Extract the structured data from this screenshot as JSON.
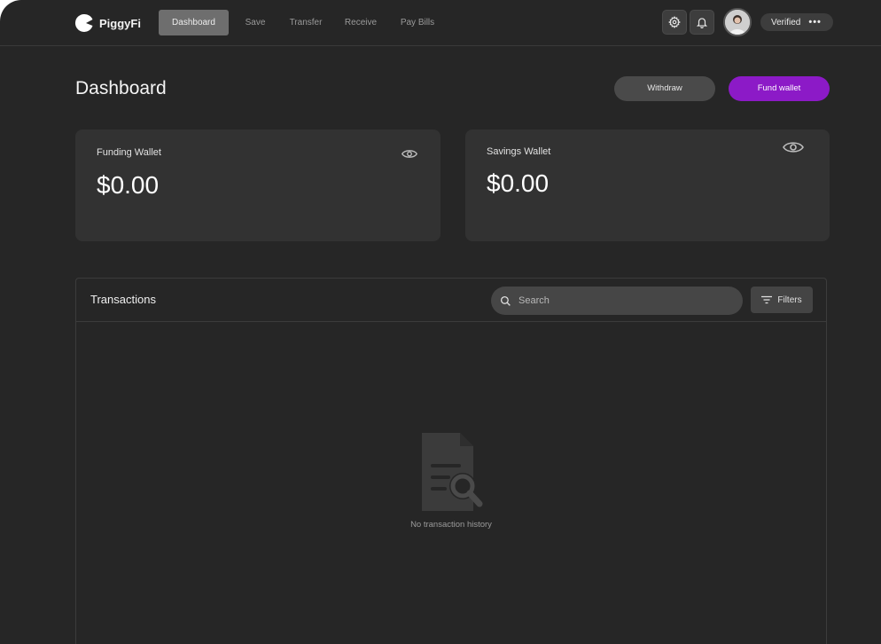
{
  "brand": {
    "name": "PiggyFi"
  },
  "nav": {
    "items": [
      {
        "label": "Dashboard",
        "active": true
      },
      {
        "label": "Save",
        "active": false
      },
      {
        "label": "Transfer",
        "active": false
      },
      {
        "label": "Receive",
        "active": false
      },
      {
        "label": "Pay Bills",
        "active": false
      }
    ]
  },
  "account": {
    "status": "Verified",
    "menu": "•••"
  },
  "header": {
    "title": "Dashboard",
    "withdraw_label": "Withdraw",
    "fund_label": "Fund wallet"
  },
  "wallets": [
    {
      "label": "Funding Wallet",
      "amount": "$0.00"
    },
    {
      "label": "Savings Wallet",
      "amount": "$0.00"
    }
  ],
  "transactions": {
    "title": "Transactions",
    "search_placeholder": "Search",
    "filters_label": "Filters",
    "empty_message": "No transaction history"
  },
  "colors": {
    "background": "#262626",
    "card": "#323232",
    "accent": "#8c1ac7",
    "active_nav": "#6e6e6e"
  },
  "icons": [
    "logo-icon",
    "gear-icon",
    "bell-icon",
    "eye-icon",
    "search-icon",
    "filter-icon",
    "document-search-icon"
  ]
}
